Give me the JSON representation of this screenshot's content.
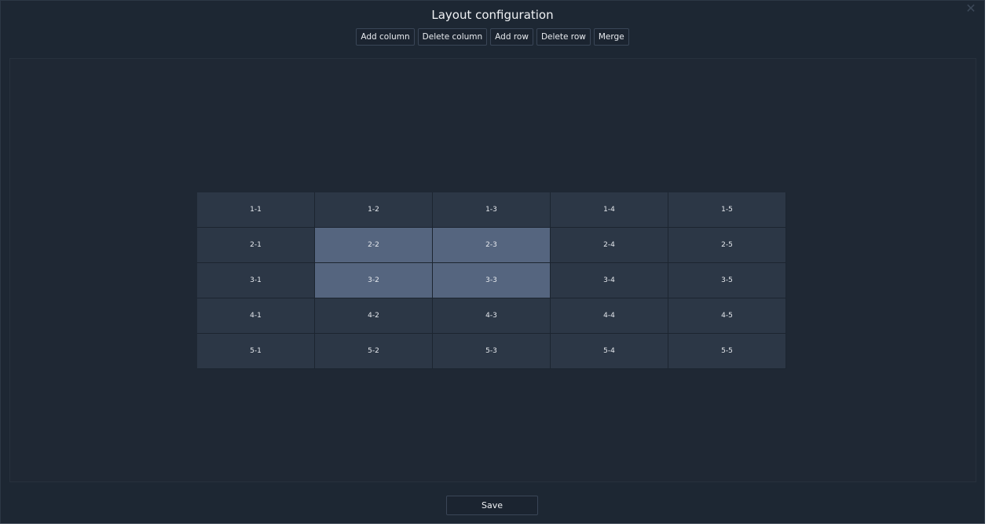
{
  "dialog": {
    "title": "Layout configuration",
    "close_icon": "close-icon",
    "close_glyph": "✕"
  },
  "toolbar": {
    "buttons": [
      {
        "id": "add-column",
        "label": "Add column"
      },
      {
        "id": "delete-column",
        "label": "Delete column"
      },
      {
        "id": "add-row",
        "label": "Add row"
      },
      {
        "id": "delete-row",
        "label": "Delete row"
      },
      {
        "id": "merge",
        "label": "Merge"
      }
    ]
  },
  "grid": {
    "rows": 5,
    "columns": 5,
    "cells": [
      [
        "1-1",
        "1-2",
        "1-3",
        "1-4",
        "1-5"
      ],
      [
        "2-1",
        "2-2",
        "2-3",
        "2-4",
        "2-5"
      ],
      [
        "3-1",
        "3-2",
        "3-3",
        "3-4",
        "3-5"
      ],
      [
        "4-1",
        "4-2",
        "4-3",
        "4-4",
        "4-5"
      ],
      [
        "5-1",
        "5-2",
        "5-3",
        "5-4",
        "5-5"
      ]
    ],
    "selected": [
      "2-2",
      "2-3",
      "3-2",
      "3-3"
    ]
  },
  "footer": {
    "save_label": "Save"
  },
  "colors": {
    "background": "#1d2733",
    "cell": "#2c3746",
    "cell_selected": "#55657f",
    "text": "#e6e9ee"
  }
}
